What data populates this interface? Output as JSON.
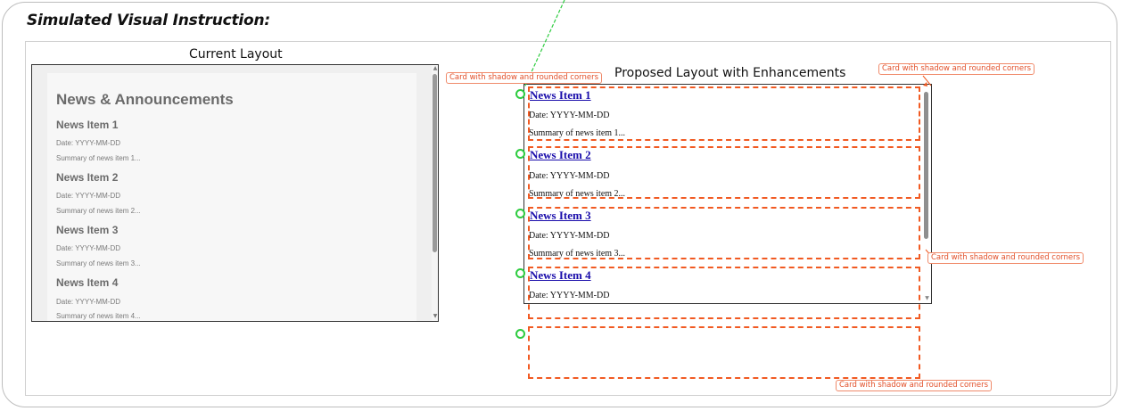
{
  "heading": "Simulated Visual Instruction:",
  "current_layout": {
    "title": "Current Layout",
    "page_title": "News & Announcements",
    "items": [
      {
        "title": "News Item 1",
        "date": "Date: YYYY-MM-DD",
        "summary": "Summary of news item 1..."
      },
      {
        "title": "News Item 2",
        "date": "Date: YYYY-MM-DD",
        "summary": "Summary of news item 2..."
      },
      {
        "title": "News Item 3",
        "date": "Date: YYYY-MM-DD",
        "summary": "Summary of news item 3..."
      },
      {
        "title": "News Item 4",
        "date": "Date: YYYY-MM-DD",
        "summary": "Summary of news item 4..."
      }
    ]
  },
  "proposed_layout": {
    "title": "Proposed Layout with Enhancements",
    "items": [
      {
        "title": "News Item 1",
        "date": "Date: YYYY-MM-DD",
        "summary": "Summary of news item 1..."
      },
      {
        "title": "News Item 2",
        "date": "Date: YYYY-MM-DD",
        "summary": "Summary of news item 2..."
      },
      {
        "title": "News Item 3",
        "date": "Date: YYYY-MM-DD",
        "summary": "Summary of news item 3..."
      },
      {
        "title": "News Item 4",
        "date": "Date: YYYY-MM-DD"
      }
    ]
  },
  "annotations": {
    "label_1": "Card with shadow and rounded corners",
    "label_2": "Card with shadow and rounded corners",
    "label_3": "Card with shadow and rounded corners",
    "label_4": "Card with shadow and rounded corners"
  },
  "colors": {
    "annotation": "#f15a22",
    "marker": "#2ecc40",
    "link": "#1a0dab"
  }
}
